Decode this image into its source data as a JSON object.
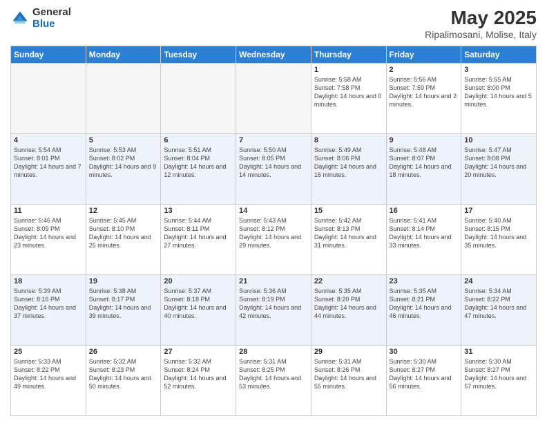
{
  "logo": {
    "general": "General",
    "blue": "Blue"
  },
  "title": {
    "month_year": "May 2025",
    "location": "Ripalimosani, Molise, Italy"
  },
  "weekdays": [
    "Sunday",
    "Monday",
    "Tuesday",
    "Wednesday",
    "Thursday",
    "Friday",
    "Saturday"
  ],
  "weeks": [
    [
      {
        "day": "",
        "empty": true
      },
      {
        "day": "",
        "empty": true
      },
      {
        "day": "",
        "empty": true
      },
      {
        "day": "",
        "empty": true
      },
      {
        "day": "1",
        "sunrise": "5:58 AM",
        "sunset": "7:58 PM",
        "daylight": "14 hours and 0 minutes."
      },
      {
        "day": "2",
        "sunrise": "5:56 AM",
        "sunset": "7:59 PM",
        "daylight": "14 hours and 2 minutes."
      },
      {
        "day": "3",
        "sunrise": "5:55 AM",
        "sunset": "8:00 PM",
        "daylight": "14 hours and 5 minutes."
      }
    ],
    [
      {
        "day": "4",
        "sunrise": "5:54 AM",
        "sunset": "8:01 PM",
        "daylight": "14 hours and 7 minutes."
      },
      {
        "day": "5",
        "sunrise": "5:53 AM",
        "sunset": "8:02 PM",
        "daylight": "14 hours and 9 minutes."
      },
      {
        "day": "6",
        "sunrise": "5:51 AM",
        "sunset": "8:04 PM",
        "daylight": "14 hours and 12 minutes."
      },
      {
        "day": "7",
        "sunrise": "5:50 AM",
        "sunset": "8:05 PM",
        "daylight": "14 hours and 14 minutes."
      },
      {
        "day": "8",
        "sunrise": "5:49 AM",
        "sunset": "8:06 PM",
        "daylight": "14 hours and 16 minutes."
      },
      {
        "day": "9",
        "sunrise": "5:48 AM",
        "sunset": "8:07 PM",
        "daylight": "14 hours and 18 minutes."
      },
      {
        "day": "10",
        "sunrise": "5:47 AM",
        "sunset": "8:08 PM",
        "daylight": "14 hours and 20 minutes."
      }
    ],
    [
      {
        "day": "11",
        "sunrise": "5:46 AM",
        "sunset": "8:09 PM",
        "daylight": "14 hours and 23 minutes."
      },
      {
        "day": "12",
        "sunrise": "5:45 AM",
        "sunset": "8:10 PM",
        "daylight": "14 hours and 25 minutes."
      },
      {
        "day": "13",
        "sunrise": "5:44 AM",
        "sunset": "8:11 PM",
        "daylight": "14 hours and 27 minutes."
      },
      {
        "day": "14",
        "sunrise": "5:43 AM",
        "sunset": "8:12 PM",
        "daylight": "14 hours and 29 minutes."
      },
      {
        "day": "15",
        "sunrise": "5:42 AM",
        "sunset": "8:13 PM",
        "daylight": "14 hours and 31 minutes."
      },
      {
        "day": "16",
        "sunrise": "5:41 AM",
        "sunset": "8:14 PM",
        "daylight": "14 hours and 33 minutes."
      },
      {
        "day": "17",
        "sunrise": "5:40 AM",
        "sunset": "8:15 PM",
        "daylight": "14 hours and 35 minutes."
      }
    ],
    [
      {
        "day": "18",
        "sunrise": "5:39 AM",
        "sunset": "8:16 PM",
        "daylight": "14 hours and 37 minutes."
      },
      {
        "day": "19",
        "sunrise": "5:38 AM",
        "sunset": "8:17 PM",
        "daylight": "14 hours and 39 minutes."
      },
      {
        "day": "20",
        "sunrise": "5:37 AM",
        "sunset": "8:18 PM",
        "daylight": "14 hours and 40 minutes."
      },
      {
        "day": "21",
        "sunrise": "5:36 AM",
        "sunset": "8:19 PM",
        "daylight": "14 hours and 42 minutes."
      },
      {
        "day": "22",
        "sunrise": "5:35 AM",
        "sunset": "8:20 PM",
        "daylight": "14 hours and 44 minutes."
      },
      {
        "day": "23",
        "sunrise": "5:35 AM",
        "sunset": "8:21 PM",
        "daylight": "14 hours and 46 minutes."
      },
      {
        "day": "24",
        "sunrise": "5:34 AM",
        "sunset": "8:22 PM",
        "daylight": "14 hours and 47 minutes."
      }
    ],
    [
      {
        "day": "25",
        "sunrise": "5:33 AM",
        "sunset": "8:22 PM",
        "daylight": "14 hours and 49 minutes."
      },
      {
        "day": "26",
        "sunrise": "5:32 AM",
        "sunset": "8:23 PM",
        "daylight": "14 hours and 50 minutes."
      },
      {
        "day": "27",
        "sunrise": "5:32 AM",
        "sunset": "8:24 PM",
        "daylight": "14 hours and 52 minutes."
      },
      {
        "day": "28",
        "sunrise": "5:31 AM",
        "sunset": "8:25 PM",
        "daylight": "14 hours and 53 minutes."
      },
      {
        "day": "29",
        "sunrise": "5:31 AM",
        "sunset": "8:26 PM",
        "daylight": "14 hours and 55 minutes."
      },
      {
        "day": "30",
        "sunrise": "5:30 AM",
        "sunset": "8:27 PM",
        "daylight": "14 hours and 56 minutes."
      },
      {
        "day": "31",
        "sunrise": "5:30 AM",
        "sunset": "8:27 PM",
        "daylight": "14 hours and 57 minutes."
      }
    ]
  ],
  "labels": {
    "sunrise": "Sunrise:",
    "sunset": "Sunset:",
    "daylight": "Daylight hours"
  }
}
